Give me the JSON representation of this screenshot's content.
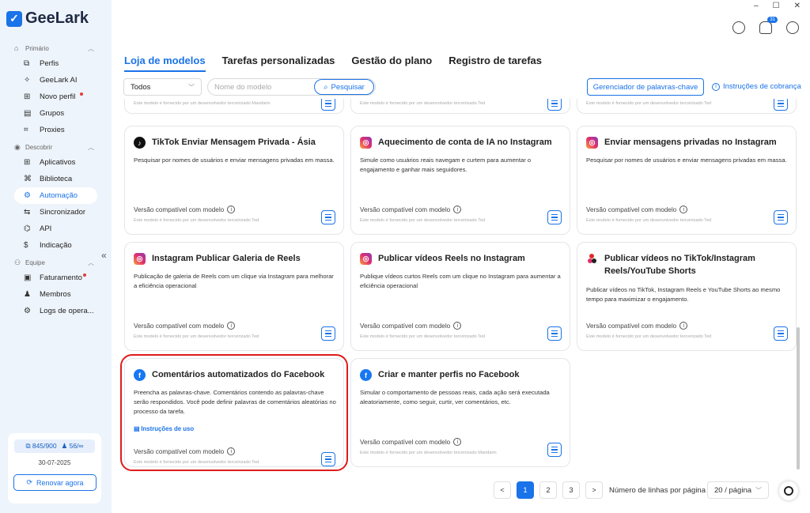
{
  "app": {
    "name": "GeeLark"
  },
  "window_controls": {
    "minimize": "–",
    "maximize": "☐",
    "close": "✕"
  },
  "header": {
    "notification_count": "31"
  },
  "sidebar": {
    "sections": [
      {
        "title": "Primário",
        "items": [
          {
            "label": "Perfis",
            "icon": "⧉"
          },
          {
            "label": "GeeLark AI",
            "icon": "✧"
          },
          {
            "label": "Novo perfil",
            "icon": "⊞",
            "dot": true
          },
          {
            "label": "Grupos",
            "icon": "▤"
          },
          {
            "label": "Proxies",
            "icon": "⌗"
          }
        ]
      },
      {
        "title": "Descobrir",
        "items": [
          {
            "label": "Aplicativos",
            "icon": "⊞"
          },
          {
            "label": "Biblioteca",
            "icon": "⌘"
          },
          {
            "label": "Automação",
            "icon": "⚙",
            "active": true
          },
          {
            "label": "Sincronizador",
            "icon": "⇆"
          },
          {
            "label": "API",
            "icon": "⌬"
          },
          {
            "label": "Indicação",
            "icon": "$"
          }
        ]
      },
      {
        "title": "Equipe",
        "items": [
          {
            "label": "Faturamento",
            "icon": "▣",
            "dot": true
          },
          {
            "label": "Membros",
            "icon": "♟"
          },
          {
            "label": "Logs de opera...",
            "icon": "⚙"
          }
        ]
      }
    ],
    "account": {
      "profiles_quota": "845/900",
      "members_quota": "56/∞",
      "date": "30-07-2025",
      "renew_label": "Renovar agora"
    }
  },
  "tabs": [
    "Loja de modelos",
    "Tarefas personalizadas",
    "Gestão do plano",
    "Registro de tarefas"
  ],
  "filters": {
    "platform": "Todos",
    "search_placeholder": "Nome do modelo",
    "search_label": "Pesquisar",
    "keyword_manager_label": "Gerenciador de palavras-chave",
    "billing_label": "Instruções de cobrança"
  },
  "partial_row": [
    "Este modelo é fornecido por um desenvolvedor terceirizado Mandarin",
    "Este modelo é fornecido por um desenvolvedor terceirizado Ted",
    "Este modelo é fornecido por um desenvolvedor terceirizado Ted"
  ],
  "cards": [
    {
      "title": "TikTok Enviar Mensagem Privada - Ásia",
      "icon": "tiktok-icon",
      "desc": "Pesquisar por nomes de usuários e enviar mensagens privadas em massa.",
      "compat": "Versão compatível com modelo",
      "provider": "Este modelo é fornecido por um desenvolvedor terceirizado Ted"
    },
    {
      "title": "Aquecimento de conta de IA no Instagram",
      "icon": "instagram-icon",
      "desc": "Simule como usuários reais navegam e curtem para aumentar o engajamento e ganhar mais seguidores.",
      "compat": "Versão compatível com modelo",
      "provider": "Este modelo é fornecido por um desenvolvedor terceirizado Ted"
    },
    {
      "title": "Enviar mensagens privadas no Instagram",
      "icon": "instagram-icon",
      "desc": "Pesquisar por nomes de usuários e enviar mensagens privadas em massa.",
      "compat": "Versão compatível com modelo",
      "provider": "Este modelo é fornecido por um desenvolvedor terceirizado Ted"
    },
    {
      "title": "Instagram Publicar Galeria de Reels",
      "icon": "instagram-icon",
      "desc": "Publicação de galeria de Reels com um clique via Instagram para melhorar a eficiência operacional",
      "compat": "Versão compatível com modelo",
      "provider": "Este modelo é fornecido por um desenvolvedor terceirizado Ted"
    },
    {
      "title": "Publicar vídeos Reels no Instagram",
      "icon": "instagram-icon",
      "desc": "Publique vídeos curtos Reels com um clique no Instagram para aumentar a eficiência operacional",
      "compat": "Versão compatível com modelo",
      "provider": "Este modelo é fornecido por um desenvolvedor terceirizado Ted"
    },
    {
      "title": "Publicar vídeos no TikTok/Instagram Reels/YouTube Shorts",
      "icon": "multi-platform-icon",
      "desc": "Publicar vídeos no TikTok, Instagram Reels e YouTube Shorts ao mesmo tempo para maximizar o engajamento.",
      "compat": "Versão compatível com modelo",
      "provider": "Este modelo é fornecido por um desenvolvedor terceirizado Ted"
    },
    {
      "title": "Comentários automatizados do Facebook",
      "icon": "facebook-icon",
      "desc": "Preencha as palavras-chave. Comentários contendo as palavras-chave serão respondidos. Você pode definir palavras de comentários aleatórias no processo da tarefa.",
      "usage": "Instruções de uso",
      "compat": "Versão compatível com modelo",
      "provider": "Este modelo é fornecido por um desenvolvedor terceirizado Ted"
    },
    {
      "title": "Criar e manter perfis no Facebook",
      "icon": "facebook-icon",
      "desc": "Simular o comportamento de pessoas reais, cada ação será executada aleatoriamente, como seguir, curtir, ver comentários, etc.",
      "compat": "Versão compatível com modelo",
      "provider": "Este modelo é fornecido por um desenvolvedor terceirizado Mandarin"
    }
  ],
  "pagination": {
    "pages": [
      "1",
      "2",
      "3"
    ],
    "current": "1",
    "rows_label": "Número de linhas por página",
    "rows_value": "20 / página",
    "prev": "<",
    "next": ">"
  }
}
